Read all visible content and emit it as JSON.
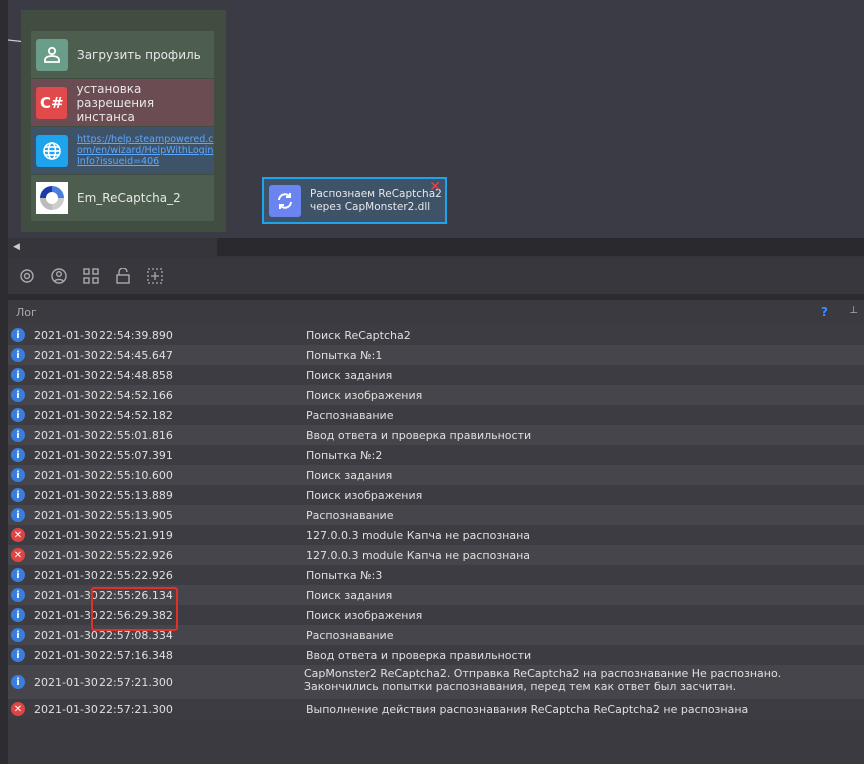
{
  "canvas": {
    "blocks": [
      {
        "label": "Загрузить профиль",
        "icon": "user-icon",
        "color": "#6a9e8a"
      },
      {
        "label1": "установка",
        "label2": "разрешения инстанса",
        "icon": "C#",
        "color": "#e04a4a"
      },
      {
        "url1": "https://help.steampowered.c",
        "url2": "om/en/wizard/HelpWithLogin",
        "url3": "Info?issueid=406",
        "icon": "globe-icon",
        "color": "#1ea4ec"
      },
      {
        "label": "Em_ReCaptcha_2",
        "icon": "recaptcha-icon"
      }
    ],
    "node": {
      "line1": "Распознаем ReCaptcha2",
      "line2": "через CapMonster2.dll",
      "close": "✕"
    }
  },
  "log": {
    "title": "Лог",
    "help": "?",
    "pin": "⊥",
    "rows": [
      {
        "type": "info",
        "date": "2021-01-30",
        "time": "22:54:39.890",
        "msg": "Поиск ReCaptcha2"
      },
      {
        "type": "info",
        "date": "2021-01-30",
        "time": "22:54:45.647",
        "msg": "Попытка №:1"
      },
      {
        "type": "info",
        "date": "2021-01-30",
        "time": "22:54:48.858",
        "msg": "Поиск задания"
      },
      {
        "type": "info",
        "date": "2021-01-30",
        "time": "22:54:52.166",
        "msg": "Поиск изображения"
      },
      {
        "type": "info",
        "date": "2021-01-30",
        "time": "22:54:52.182",
        "msg": "Распознавание"
      },
      {
        "type": "info",
        "date": "2021-01-30",
        "time": "22:55:01.816",
        "msg": "Ввод ответа и проверка правильности"
      },
      {
        "type": "info",
        "date": "2021-01-30",
        "time": "22:55:07.391",
        "msg": "Попытка №:2"
      },
      {
        "type": "info",
        "date": "2021-01-30",
        "time": "22:55:10.600",
        "msg": "Поиск задания"
      },
      {
        "type": "info",
        "date": "2021-01-30",
        "time": "22:55:13.889",
        "msg": "Поиск изображения"
      },
      {
        "type": "info",
        "date": "2021-01-30",
        "time": "22:55:13.905",
        "msg": "Распознавание"
      },
      {
        "type": "error",
        "date": "2021-01-30",
        "time": "22:55:21.919",
        "msg": "127.0.0.3 module Капча не распознана"
      },
      {
        "type": "error",
        "date": "2021-01-30",
        "time": "22:55:22.926",
        "msg": "127.0.0.3 module Капча не распознана"
      },
      {
        "type": "info",
        "date": "2021-01-30",
        "time": "22:55:22.926",
        "msg": "Попытка №:3"
      },
      {
        "type": "info",
        "date": "2021-01-30",
        "time": "22:55:26.134",
        "msg": "Поиск задания"
      },
      {
        "type": "info",
        "date": "2021-01-30",
        "time": "22:56:29.382",
        "msg": "Поиск изображения"
      },
      {
        "type": "info",
        "date": "2021-01-30",
        "time": "22:57:08.334",
        "msg": "Распознавание"
      },
      {
        "type": "info",
        "date": "2021-01-30",
        "time": "22:57:16.348",
        "msg": "Ввод ответа и проверка правильности"
      },
      {
        "type": "info",
        "date": "2021-01-30",
        "time": "22:57:21.300",
        "msg": "CapMonster2 ReCaptcha2. Отправка ReCaptcha2 на распознавание Не распознано. Закончились попытки распознавания, перед тем как ответ был засчитан."
      },
      {
        "type": "error",
        "date": "2021-01-30",
        "time": "22:57:21.300",
        "msg": "Выполнение действия распознавания ReCaptcha ReCaptcha2 не распознана"
      }
    ]
  },
  "colors": {
    "info": "#3b7ddd",
    "error": "#e04545",
    "highlight": "#e0302a"
  }
}
